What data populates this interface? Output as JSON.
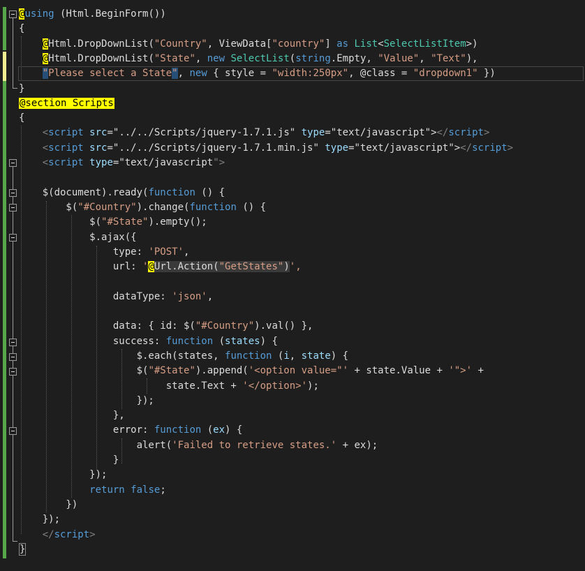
{
  "editor": {
    "language": "Razor / C# with JavaScript",
    "colors": {
      "background": "#1e1e1e",
      "keyword": "#569cd6",
      "string": "#d69d85",
      "type": "#4ec9b0",
      "razor_transition": "#ffff00",
      "change_marker_saved": "#57a64a",
      "change_marker_unsaved": "#efef91"
    },
    "lines": [
      [
        {
          "t": "@",
          "c": "rz"
        },
        {
          "t": "using",
          "c": "k"
        },
        {
          "t": " (Html.",
          "c": "f"
        },
        {
          "t": "BeginForm",
          "c": "f"
        },
        {
          "t": "())",
          "c": "f"
        }
      ],
      [
        {
          "t": "{",
          "c": "f"
        }
      ],
      [
        {
          "t": "    ",
          "c": "f"
        },
        {
          "t": "@",
          "c": "rz"
        },
        {
          "t": "Html.DropDownList(",
          "c": "f"
        },
        {
          "t": "\"Country\"",
          "c": "s"
        },
        {
          "t": ", ViewData[",
          "c": "f"
        },
        {
          "t": "\"country\"",
          "c": "s"
        },
        {
          "t": "] ",
          "c": "f"
        },
        {
          "t": "as",
          "c": "k"
        },
        {
          "t": " ",
          "c": "f"
        },
        {
          "t": "List",
          "c": "t"
        },
        {
          "t": "<",
          "c": "f"
        },
        {
          "t": "SelectListItem",
          "c": "t"
        },
        {
          "t": ">)",
          "c": "f"
        }
      ],
      [
        {
          "t": "    ",
          "c": "f"
        },
        {
          "t": "@",
          "c": "rz"
        },
        {
          "t": "Html.DropDownList(",
          "c": "f"
        },
        {
          "t": "\"State\"",
          "c": "s"
        },
        {
          "t": ", ",
          "c": "f"
        },
        {
          "t": "new",
          "c": "k"
        },
        {
          "t": " ",
          "c": "f"
        },
        {
          "t": "SelectList",
          "c": "t"
        },
        {
          "t": "(",
          "c": "f"
        },
        {
          "t": "string",
          "c": "k"
        },
        {
          "t": ".Empty, ",
          "c": "f"
        },
        {
          "t": "\"Value\"",
          "c": "s"
        },
        {
          "t": ", ",
          "c": "f"
        },
        {
          "t": "\"Text\"",
          "c": "s"
        },
        {
          "t": "),",
          "c": "f"
        }
      ],
      [
        {
          "t": "    ",
          "c": "f"
        },
        {
          "t": "\"",
          "c": "s selbr"
        },
        {
          "t": "Please select a State",
          "c": "s"
        },
        {
          "t": "\"",
          "c": "s selbr"
        },
        {
          "t": ", ",
          "c": "f"
        },
        {
          "t": "new",
          "c": "k"
        },
        {
          "t": " { style = ",
          "c": "f"
        },
        {
          "t": "\"width:250px\"",
          "c": "s"
        },
        {
          "t": ", @class = ",
          "c": "f"
        },
        {
          "t": "\"dropdown1\"",
          "c": "s"
        },
        {
          "t": " })",
          "c": "f"
        }
      ],
      [
        {
          "t": "}",
          "c": "f"
        }
      ],
      [
        {
          "t": "@section Scripts",
          "c": "rzsec"
        }
      ],
      [
        {
          "t": "{",
          "c": "f"
        }
      ],
      [
        {
          "t": "    ",
          "c": "f"
        },
        {
          "t": "<",
          "c": "g"
        },
        {
          "t": "script",
          "c": "k"
        },
        {
          "t": " ",
          "c": "f"
        },
        {
          "t": "src",
          "c": "p"
        },
        {
          "t": "=\"",
          "c": "f"
        },
        {
          "t": "../../Scripts/jquery-1.7.1.js",
          "c": "f"
        },
        {
          "t": "\" ",
          "c": "f"
        },
        {
          "t": "type",
          "c": "p"
        },
        {
          "t": "=\"",
          "c": "f"
        },
        {
          "t": "text/javascript",
          "c": "f"
        },
        {
          "t": "\">",
          "c": "f"
        },
        {
          "t": "</",
          "c": "g"
        },
        {
          "t": "script",
          "c": "k"
        },
        {
          "t": ">",
          "c": "g"
        }
      ],
      [
        {
          "t": "    ",
          "c": "f"
        },
        {
          "t": "<",
          "c": "g"
        },
        {
          "t": "script",
          "c": "k"
        },
        {
          "t": " ",
          "c": "f"
        },
        {
          "t": "src",
          "c": "p"
        },
        {
          "t": "=\"",
          "c": "f"
        },
        {
          "t": "../../Scripts/jquery-1.7.1.min.js",
          "c": "f"
        },
        {
          "t": "\" ",
          "c": "f"
        },
        {
          "t": "type",
          "c": "p"
        },
        {
          "t": "=\"",
          "c": "f"
        },
        {
          "t": "text/javascript",
          "c": "f"
        },
        {
          "t": "\">",
          "c": "f"
        },
        {
          "t": "</",
          "c": "g"
        },
        {
          "t": "script",
          "c": "k"
        },
        {
          "t": ">",
          "c": "g"
        }
      ],
      [
        {
          "t": "    ",
          "c": "f"
        },
        {
          "t": "<",
          "c": "g"
        },
        {
          "t": "script",
          "c": "k"
        },
        {
          "t": " ",
          "c": "f"
        },
        {
          "t": "type",
          "c": "p"
        },
        {
          "t": "=\"",
          "c": "f"
        },
        {
          "t": "text/javascript",
          "c": "f"
        },
        {
          "t": "\">",
          "c": "g"
        }
      ],
      [],
      [
        {
          "t": "    $(document).ready(",
          "c": "f"
        },
        {
          "t": "function",
          "c": "k"
        },
        {
          "t": " () {",
          "c": "f"
        }
      ],
      [
        {
          "t": "        $(",
          "c": "f"
        },
        {
          "t": "\"#Country\"",
          "c": "s"
        },
        {
          "t": ").change(",
          "c": "f"
        },
        {
          "t": "function",
          "c": "k"
        },
        {
          "t": " () {",
          "c": "f"
        }
      ],
      [
        {
          "t": "            $(",
          "c": "f"
        },
        {
          "t": "\"#State\"",
          "c": "s"
        },
        {
          "t": ").empty();",
          "c": "f"
        }
      ],
      [
        {
          "t": "            $.ajax({",
          "c": "f"
        }
      ],
      [
        {
          "t": "                type: ",
          "c": "f"
        },
        {
          "t": "'POST'",
          "c": "s"
        },
        {
          "t": ",",
          "c": "f"
        }
      ],
      [
        {
          "t": "                url: ",
          "c": "f"
        },
        {
          "t": "'",
          "c": "s"
        },
        {
          "t": "@",
          "c": "rz"
        },
        {
          "t": "Url.Action(",
          "c": "f rzbg"
        },
        {
          "t": "\"GetStates\"",
          "c": "s rzbg"
        },
        {
          "t": ")",
          "c": "f rzbg"
        },
        {
          "t": "',",
          "c": "s"
        }
      ],
      [],
      [
        {
          "t": "                dataType: ",
          "c": "f"
        },
        {
          "t": "'json'",
          "c": "s"
        },
        {
          "t": ",",
          "c": "f"
        }
      ],
      [],
      [
        {
          "t": "                data: { id: $(",
          "c": "f"
        },
        {
          "t": "\"#Country\"",
          "c": "s"
        },
        {
          "t": ").val() },",
          "c": "f"
        }
      ],
      [
        {
          "t": "                success: ",
          "c": "f"
        },
        {
          "t": "function",
          "c": "k"
        },
        {
          "t": " (",
          "c": "f"
        },
        {
          "t": "states",
          "c": "p"
        },
        {
          "t": ") {",
          "c": "f"
        }
      ],
      [
        {
          "t": "                    $.each(states, ",
          "c": "f"
        },
        {
          "t": "function",
          "c": "k"
        },
        {
          "t": " (",
          "c": "f"
        },
        {
          "t": "i",
          "c": "p"
        },
        {
          "t": ", ",
          "c": "f"
        },
        {
          "t": "state",
          "c": "p"
        },
        {
          "t": ") {",
          "c": "f"
        }
      ],
      [
        {
          "t": "                    $(",
          "c": "f"
        },
        {
          "t": "\"#State\"",
          "c": "s"
        },
        {
          "t": ").append(",
          "c": "f"
        },
        {
          "t": "'<option value=\"'",
          "c": "s"
        },
        {
          "t": " + state.Value + ",
          "c": "f"
        },
        {
          "t": "'\">'",
          "c": "s"
        },
        {
          "t": " +",
          "c": "f"
        }
      ],
      [
        {
          "t": "                         state.Text + ",
          "c": "f"
        },
        {
          "t": "'</option>'",
          "c": "s"
        },
        {
          "t": ");",
          "c": "f"
        }
      ],
      [
        {
          "t": "                    });",
          "c": "f"
        }
      ],
      [
        {
          "t": "                },",
          "c": "f"
        }
      ],
      [
        {
          "t": "                error: ",
          "c": "f"
        },
        {
          "t": "function",
          "c": "k"
        },
        {
          "t": " (",
          "c": "f"
        },
        {
          "t": "ex",
          "c": "p"
        },
        {
          "t": ") {",
          "c": "f"
        }
      ],
      [
        {
          "t": "                    alert(",
          "c": "f"
        },
        {
          "t": "'Failed to retrieve states.'",
          "c": "s"
        },
        {
          "t": " + ex);",
          "c": "f"
        }
      ],
      [
        {
          "t": "                }",
          "c": "f"
        }
      ],
      [
        {
          "t": "            });",
          "c": "f"
        }
      ],
      [
        {
          "t": "            ",
          "c": "f"
        },
        {
          "t": "return",
          "c": "k"
        },
        {
          "t": " ",
          "c": "f"
        },
        {
          "t": "false",
          "c": "k"
        },
        {
          "t": ";",
          "c": "f"
        }
      ],
      [
        {
          "t": "        })",
          "c": "f"
        }
      ],
      [
        {
          "t": "    });",
          "c": "f"
        }
      ],
      [
        {
          "t": "    ",
          "c": "f"
        },
        {
          "t": "</",
          "c": "g"
        },
        {
          "t": "script",
          "c": "k"
        },
        {
          "t": ">",
          "c": "g"
        }
      ],
      [
        {
          "t": "}",
          "c": "f bm"
        }
      ]
    ]
  }
}
